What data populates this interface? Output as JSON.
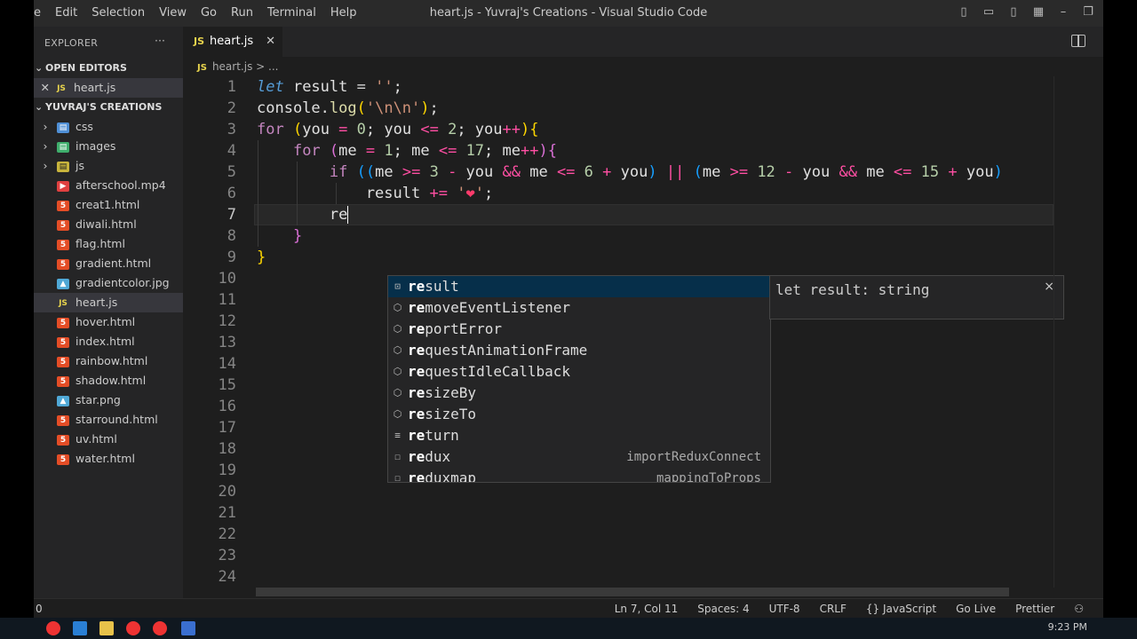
{
  "titlebar": {
    "menu": [
      "e",
      "Edit",
      "Selection",
      "View",
      "Go",
      "Run",
      "Terminal",
      "Help"
    ],
    "title": "heart.js - Yuvraj's Creations - Visual Studio Code"
  },
  "sidebar": {
    "header": "EXPLORER",
    "dots": "···",
    "open_editors_label": "OPEN EDITORS",
    "open_editor_item": {
      "icon": "JS",
      "name": "heart.js"
    },
    "project_label": "YUVRAJ'S CREATIONS",
    "items": [
      {
        "name": "css",
        "type": "folder"
      },
      {
        "name": "images",
        "type": "folderimg"
      },
      {
        "name": "js",
        "type": "folderjs"
      },
      {
        "name": "afterschool.mp4",
        "type": "mp4"
      },
      {
        "name": "creat1.html",
        "type": "html"
      },
      {
        "name": "diwali.html",
        "type": "html"
      },
      {
        "name": "flag.html",
        "type": "html"
      },
      {
        "name": "gradient.html",
        "type": "html"
      },
      {
        "name": "gradientcolor.jpg",
        "type": "img"
      },
      {
        "name": "heart.js",
        "type": "js"
      },
      {
        "name": "hover.html",
        "type": "html"
      },
      {
        "name": "index.html",
        "type": "html"
      },
      {
        "name": "rainbow.html",
        "type": "html"
      },
      {
        "name": "shadow.html",
        "type": "html"
      },
      {
        "name": "star.png",
        "type": "img"
      },
      {
        "name": "starround.html",
        "type": "html"
      },
      {
        "name": "uv.html",
        "type": "html"
      },
      {
        "name": "water.html",
        "type": "html"
      }
    ]
  },
  "editor": {
    "tab": {
      "icon": "JS",
      "name": "heart.js",
      "close": "✕"
    },
    "breadcrumb": {
      "icon": "JS",
      "text": "heart.js > ..."
    },
    "line_numbers": [
      "1",
      "2",
      "3",
      "4",
      "5",
      "6",
      "7",
      "8",
      "9",
      "10",
      "11",
      "12",
      "13",
      "14",
      "15",
      "16",
      "17",
      "18",
      "19",
      "20",
      "21",
      "22",
      "23",
      "24"
    ],
    "typed": "re"
  },
  "suggestions": [
    {
      "match": "re",
      "rest": "sult",
      "icon": "variable",
      "detail": ""
    },
    {
      "match": "re",
      "rest": "moveEventListener",
      "icon": "method",
      "detail": ""
    },
    {
      "match": "re",
      "rest": "portError",
      "icon": "method",
      "detail": ""
    },
    {
      "match": "re",
      "rest": "questAnimationFrame",
      "icon": "method",
      "detail": ""
    },
    {
      "match": "re",
      "rest": "questIdleCallback",
      "icon": "method",
      "detail": ""
    },
    {
      "match": "re",
      "rest": "sizeBy",
      "icon": "method",
      "detail": ""
    },
    {
      "match": "re",
      "rest": "sizeTo",
      "icon": "method",
      "detail": ""
    },
    {
      "match": "re",
      "rest": "turn",
      "icon": "keyword",
      "detail": ""
    },
    {
      "match": "re",
      "rest": "dux",
      "icon": "snippet",
      "detail": "importReduxConnect"
    },
    {
      "match": "re",
      "rest": "duxmap",
      "icon": "snippet",
      "detail": "mappingToProps"
    }
  ],
  "suggest_detail": {
    "text": "let result: string",
    "close": "×"
  },
  "statusbar": {
    "left": "0",
    "items": [
      "Ln 7, Col 11",
      "Spaces: 4",
      "UTF-8",
      "CRLF",
      "{} JavaScript",
      "Go Live",
      "Prettier"
    ]
  },
  "taskbar": {
    "time": "9:23 PM"
  }
}
